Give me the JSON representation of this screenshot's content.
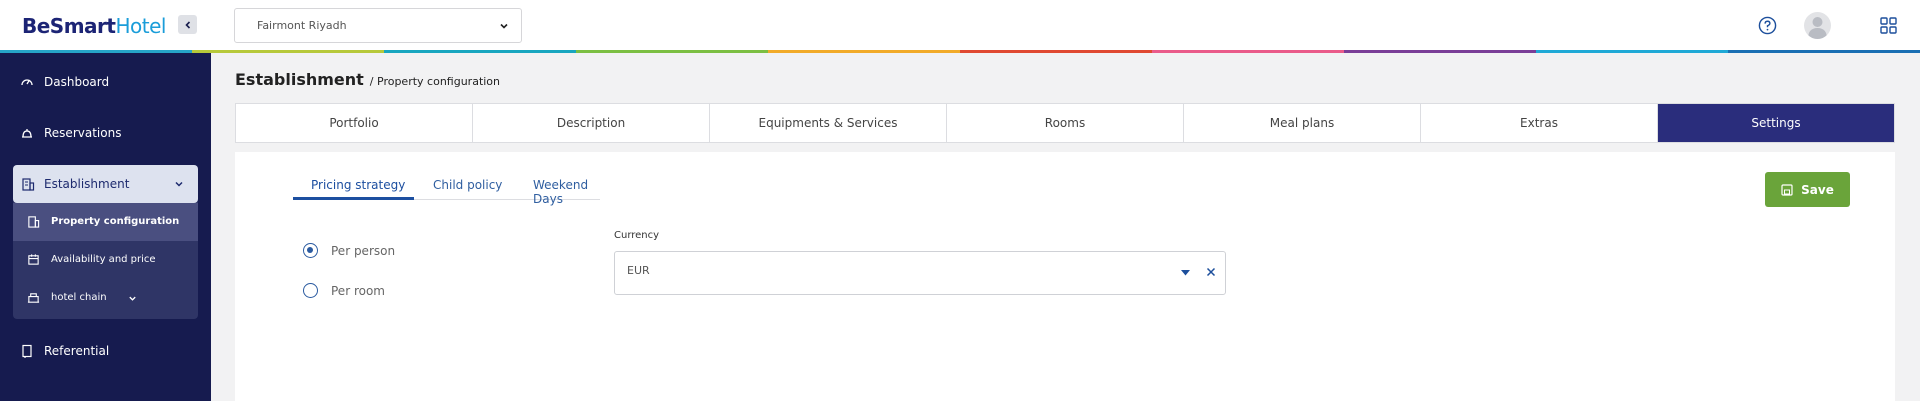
{
  "app": {
    "logo_part1": "BeSmart",
    "logo_part2": "Hotel"
  },
  "header": {
    "hotel_select": "Fairmont Riyadh",
    "rainbow": [
      "#26a5c8",
      "#b7c93a",
      "#19a6bf",
      "#7cbf42",
      "#f2ab29",
      "#e04931",
      "#ea5b8a",
      "#7a3e97",
      "#1fa9d6",
      "#1b6fb3"
    ]
  },
  "sidebar": {
    "items": [
      {
        "label": "Dashboard",
        "icon": "gauge-icon"
      },
      {
        "label": "Reservations",
        "icon": "bell-icon"
      },
      {
        "label": "Referential",
        "icon": "book-icon"
      }
    ],
    "establishment": {
      "label": "Establishment",
      "sub": [
        {
          "label": "Property configuration"
        },
        {
          "label": "Availability and price"
        },
        {
          "label": "hotel chain"
        }
      ]
    }
  },
  "breadcrumb": {
    "title": "Establishment",
    "sub": "/ Property configuration"
  },
  "tabs": [
    "Portfolio",
    "Description",
    "Equipments & Services",
    "Rooms",
    "Meal plans",
    "Extras",
    "Settings"
  ],
  "subtabs": [
    "Pricing strategy",
    "Child policy",
    "Weekend Days"
  ],
  "save_label": "Save",
  "pricing": {
    "options": [
      "Per person",
      "Per room"
    ],
    "selected": "Per person"
  },
  "currency": {
    "label": "Currency",
    "value": "EUR"
  },
  "colors": {
    "sidebar": "#161b4f",
    "active_tab": "#2a2d7c",
    "save": "#6aa43a"
  }
}
